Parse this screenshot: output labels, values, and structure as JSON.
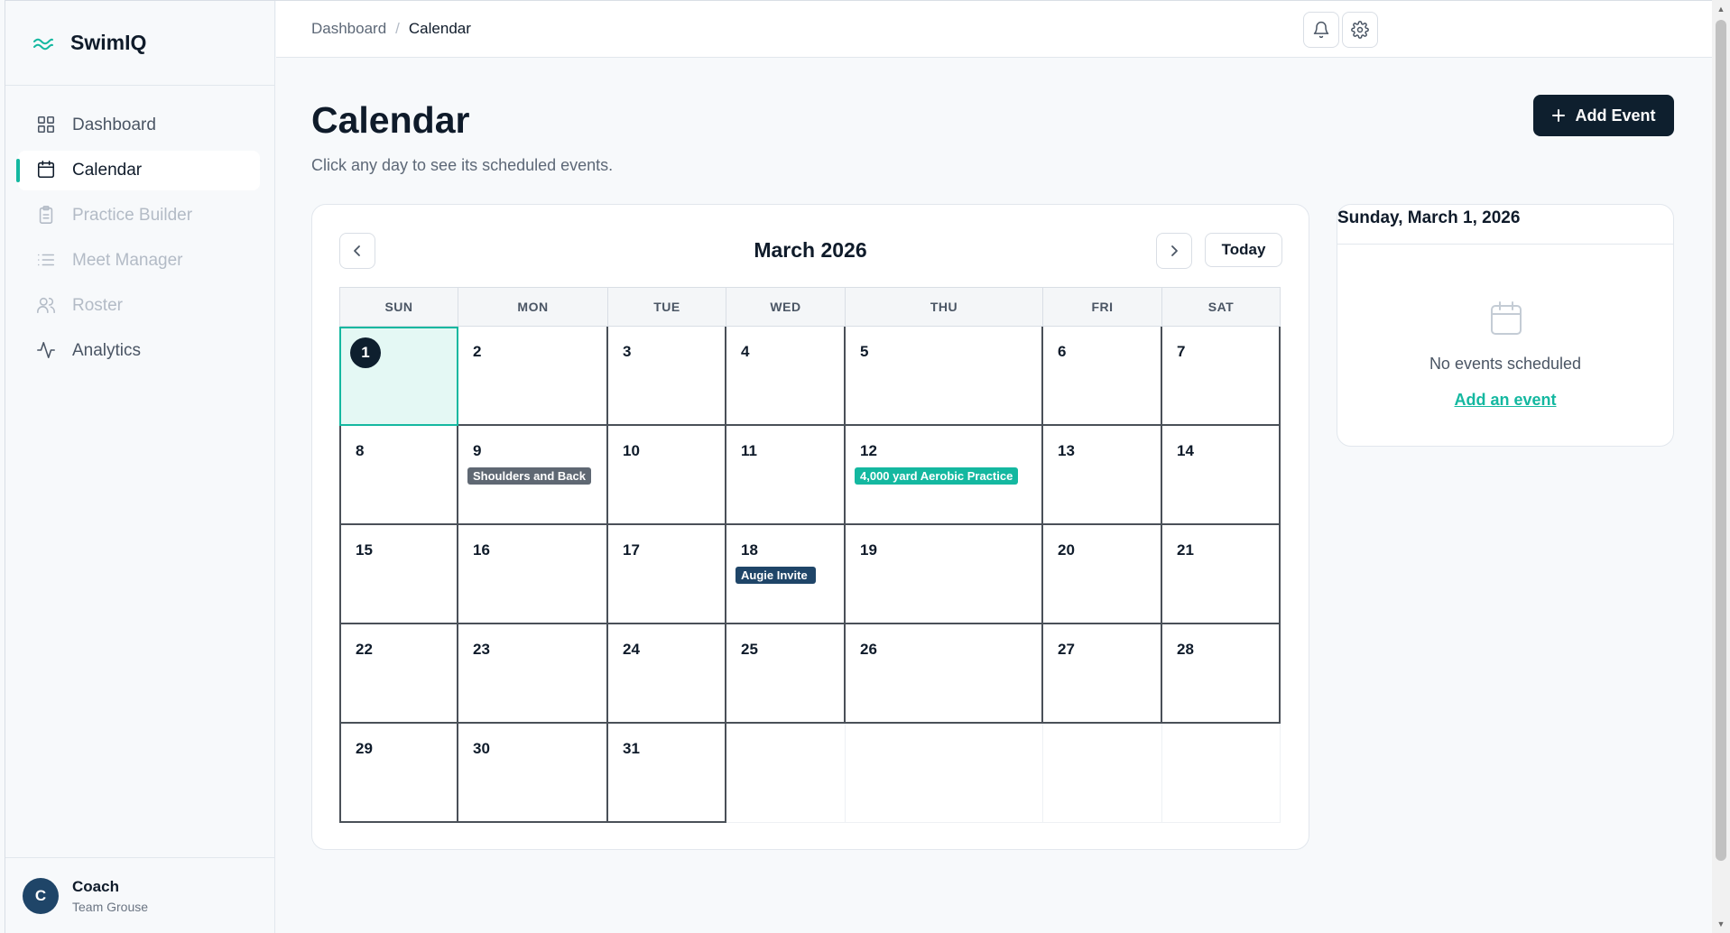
{
  "app": {
    "name": "SwimIQ"
  },
  "sidebar": {
    "items": [
      {
        "label": "Dashboard",
        "icon": "dashboard-grid-icon",
        "state": "normal"
      },
      {
        "label": "Calendar",
        "icon": "calendar-icon",
        "state": "active"
      },
      {
        "label": "Practice Builder",
        "icon": "clipboard-icon",
        "state": "disabled"
      },
      {
        "label": "Meet Manager",
        "icon": "list-icon",
        "state": "disabled"
      },
      {
        "label": "Roster",
        "icon": "users-icon",
        "state": "disabled"
      },
      {
        "label": "Analytics",
        "icon": "activity-icon",
        "state": "normal"
      }
    ],
    "user": {
      "initial": "C",
      "name": "Coach",
      "team": "Team Grouse"
    }
  },
  "breadcrumb": {
    "parent": "Dashboard",
    "separator": "/",
    "current": "Calendar"
  },
  "header": {
    "title": "Calendar",
    "subtitle": "Click any day to see its scheduled events.",
    "add_button": "Add Event"
  },
  "calendar": {
    "month_label": "March 2026",
    "today_button": "Today",
    "weekdays": [
      "SUN",
      "MON",
      "TUE",
      "WED",
      "THU",
      "FRI",
      "SAT"
    ],
    "selected_day": 1,
    "days": [
      1,
      2,
      3,
      4,
      5,
      6,
      7,
      8,
      9,
      10,
      11,
      12,
      13,
      14,
      15,
      16,
      17,
      18,
      19,
      20,
      21,
      22,
      23,
      24,
      25,
      26,
      27,
      28,
      29,
      30,
      31
    ],
    "events": [
      {
        "day": 9,
        "title": "Shoulders and Back",
        "color": "#5f6873"
      },
      {
        "day": 12,
        "title": "4,000 yard Aerobic Practice",
        "color": "#14b8a0"
      },
      {
        "day": 18,
        "title": "Augie Invite",
        "color": "#1f4568"
      }
    ]
  },
  "side_panel": {
    "date": "Sunday, March 1, 2026",
    "empty_text": "No events scheduled",
    "add_link": "Add an event"
  },
  "colors": {
    "accent": "#14b8a0",
    "primary_dark": "#0e1f2e",
    "navy": "#1f4568"
  }
}
